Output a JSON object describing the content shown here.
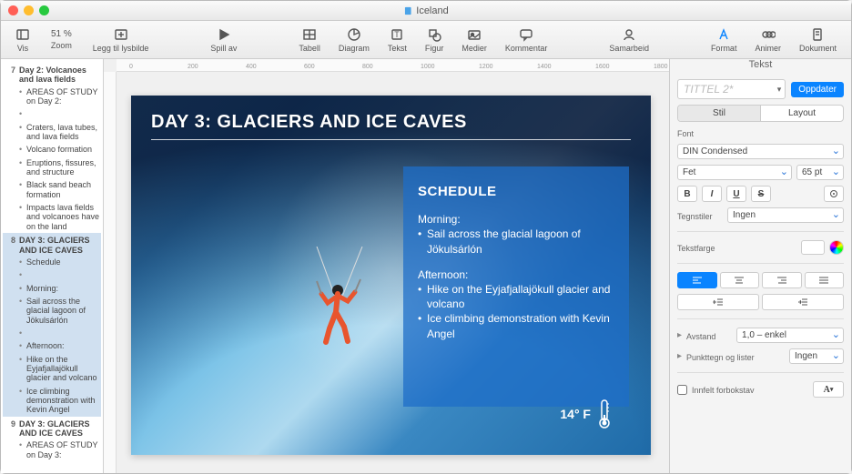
{
  "title": "Iceland",
  "toolbar": {
    "vis": "Vis",
    "zoom": "Zoom",
    "zoom_val": "51 %",
    "add_slide": "Legg til lysbilde",
    "play": "Spill av",
    "table": "Tabell",
    "chart": "Diagram",
    "text": "Tekst",
    "shape": "Figur",
    "media": "Medier",
    "comment": "Kommentar",
    "collab": "Samarbeid",
    "format": "Format",
    "animate": "Animer",
    "document": "Dokument"
  },
  "outline": {
    "s7": {
      "num": "7",
      "title": "Day 2: Volcanoes and lava fields",
      "items": [
        "AREAS OF STUDY on Day 2:",
        "",
        "Craters, lava tubes, and lava fields",
        "Volcano formation",
        "Eruptions, fissures, and structure",
        "Black sand beach formation",
        "Impacts lava fields and volcanoes have on the land"
      ]
    },
    "s8": {
      "num": "8",
      "title": "DAY 3: GLACIERS AND ICE CAVES",
      "items": [
        "Schedule",
        "",
        "Morning:",
        "Sail across the glacial lagoon of Jökulsárlón",
        "",
        "Afternoon:",
        "Hike on the Eyjafjallajökull glacier and volcano",
        "Ice climbing demonstration with Kevin Angel"
      ]
    },
    "s9": {
      "num": "9",
      "title": "DAY 3: GLACIERS AND ICE CAVES",
      "items": [
        "AREAS OF STUDY on Day 3:"
      ]
    }
  },
  "slide": {
    "title": "DAY 3: GLACIERS AND ICE CAVES",
    "schedule_label": "SCHEDULE",
    "morning_label": "Morning:",
    "morning_item1": "Sail across the glacial lagoon of Jökulsárlón",
    "afternoon_label": "Afternoon:",
    "afternoon_item1": "Hike on the Eyjafjallajökull glacier and volcano",
    "afternoon_item2": "Ice climbing demonstration with Kevin Angel",
    "temp": "14° F"
  },
  "inspector": {
    "header": "Tekst",
    "style_well": "TITTEL 2*",
    "update": "Oppdater",
    "tab_stil": "Stil",
    "tab_layout": "Layout",
    "font_label": "Font",
    "font_family": "DIN Condensed",
    "font_weight": "Fet",
    "font_size": "65 pt",
    "char_styles_label": "Tegnstiler",
    "char_styles_val": "Ingen",
    "text_color_label": "Tekstfarge",
    "spacing_label": "Avstand",
    "spacing_val": "1,0 – enkel",
    "bullets_label": "Punkttegn og lister",
    "bullets_val": "Ingen",
    "dropcap_label": "Innfelt forbokstav"
  },
  "ruler": {
    "r0": "0",
    "r200": "200",
    "r400": "400",
    "r600": "600",
    "r800": "800",
    "r1000": "1000",
    "r1200": "1200",
    "r1400": "1400",
    "r1600": "1600",
    "r1800": "1800"
  }
}
